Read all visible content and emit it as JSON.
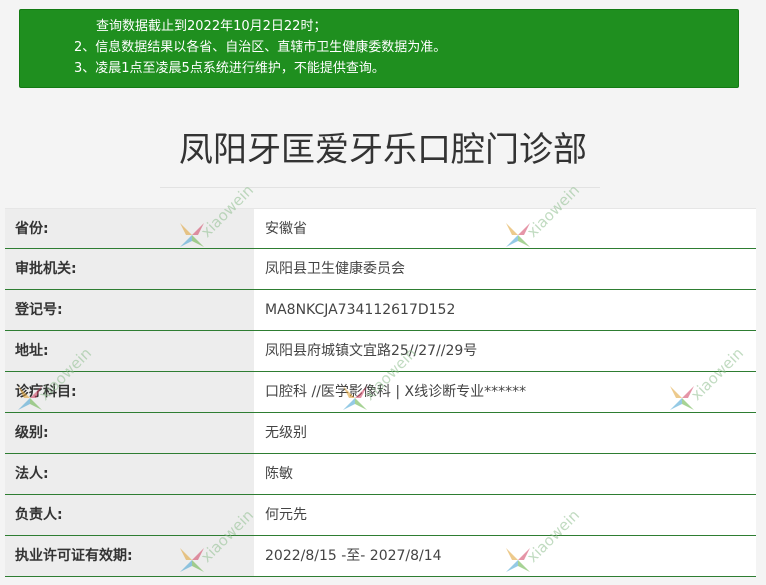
{
  "notice": {
    "lines": [
      "查询数据截止到2022年10月2日22时；",
      "2、信息数据结果以各省、自治区、直辖市卫生健康委数据为准。",
      "3、凌晨1点至凌晨5点系统进行维护，不能提供查询。"
    ]
  },
  "page_title": "凤阳牙匡爱牙乐口腔门诊部",
  "rows": [
    {
      "label": "省份:",
      "value": "安徽省"
    },
    {
      "label": "审批机关:",
      "value": "凤阳县卫生健康委员会"
    },
    {
      "label": "登记号:",
      "value": "MA8NKCJA734112617D152"
    },
    {
      "label": "地址:",
      "value": "凤阳县府城镇文宜路25//27//29号"
    },
    {
      "label": "诊疗科目:",
      "value": "口腔科 //医学影像科 | X线诊断专业******"
    },
    {
      "label": "级别:",
      "value": "无级别"
    },
    {
      "label": "法人:",
      "value": "陈敏"
    },
    {
      "label": "负责人:",
      "value": "何元先"
    },
    {
      "label": "执业许可证有效期:",
      "value": "2022/8/15 -至- 2027/8/14"
    }
  ],
  "watermark": {
    "text": "xiaowein",
    "icon": "flower-logo-icon"
  },
  "colors": {
    "notice_bg": "#1f8f1f",
    "row_rule": "#2e7d32",
    "label_bg": "#ededed"
  }
}
